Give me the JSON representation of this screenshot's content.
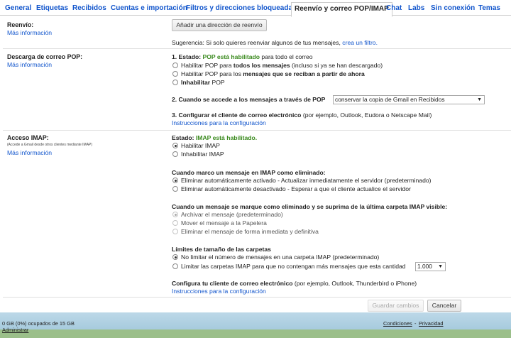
{
  "tabs": [
    "General",
    "Etiquetas",
    "Recibidos",
    "Cuentas e importación",
    "Filtros y direcciones bloqueadas",
    "Reenvío y correo POP/IMAP",
    "Chat",
    "Labs",
    "Sin conexión",
    "Temas"
  ],
  "more_info": "Más información",
  "reenvio": {
    "label": "Reenvío:",
    "add_button": "Añadir una dirección de reenvío",
    "tip_prefix": "Sugerencia: Si solo quieres reenviar algunos de tus mensajes,",
    "tip_link": "crea un filtro."
  },
  "pop": {
    "label": "Descarga de correo POP:",
    "status_prefix": "1. Estado:",
    "status_value": "POP está habilitado",
    "status_suffix": "para todo el correo",
    "opt1_a": "Habilitar POP para",
    "opt1_b": "todos los mensajes",
    "opt1_c": "(incluso si ya se han descargado)",
    "opt2_a": "Habilitar POP para los",
    "opt2_b": "mensajes que se reciban a partir de ahora",
    "opt3_a": "Inhabilitar",
    "opt3_b": "POP",
    "q2": "2. Cuando se accede a los mensajes a través de POP",
    "q2_select": "conservar la copia de Gmail en Recibidos",
    "q3": "3. Configurar el cliente de correo electrónico",
    "q3_suffix": "(por ejemplo, Outlook, Eudora o Netscape Mail)",
    "q3_link": "Instrucciones para la configuración"
  },
  "imap": {
    "label": "Acceso IMAP:",
    "tiny": "(Accede a Gmail desde otros clientes mediante IMAP)",
    "status_prefix": "Estado:",
    "status_value": "IMAP está habilitado.",
    "enable": "Habilitar IMAP",
    "disable": "Inhabilitar IMAP",
    "del_title": "Cuando marco un mensaje en IMAP como eliminado:",
    "del_opt1": "Eliminar automáticamente activado - Actualizar inmediatamente el servidor (predeterminado)",
    "del_opt2": "Eliminar automáticamente desactivado - Esperar a que el cliente actualice el servidor",
    "exp_title": "Cuando un mensaje se marque como eliminado y se suprima de la última carpeta IMAP visible:",
    "exp_opt1": "Archivar el mensaje (predeterminado)",
    "exp_opt2": "Mover el mensaje a la Papelera",
    "exp_opt3": "Eliminar el mensaje de forma inmediata y definitiva",
    "size_title": "Límites de tamaño de las carpetas",
    "size_opt1": "No limitar el número de mensajes en una carpeta IMAP (predeterminado)",
    "size_opt2": "Limitar las carpetas IMAP para que no contengan más mensajes que esta cantidad",
    "size_select": "1.000",
    "client_title": "Configura tu cliente de correo electrónico",
    "client_suffix": "(por ejemplo, Outlook, Thunderbird o iPhone)",
    "client_link": "Instrucciones para la configuración"
  },
  "actions": {
    "save": "Guardar cambios",
    "cancel": "Cancelar"
  },
  "footer": {
    "storage": "0 GB (0%) ocupados de 15 GB",
    "manage": "Administrar",
    "terms": "Condiciones",
    "dash": "-",
    "privacy": "Privacidad"
  }
}
